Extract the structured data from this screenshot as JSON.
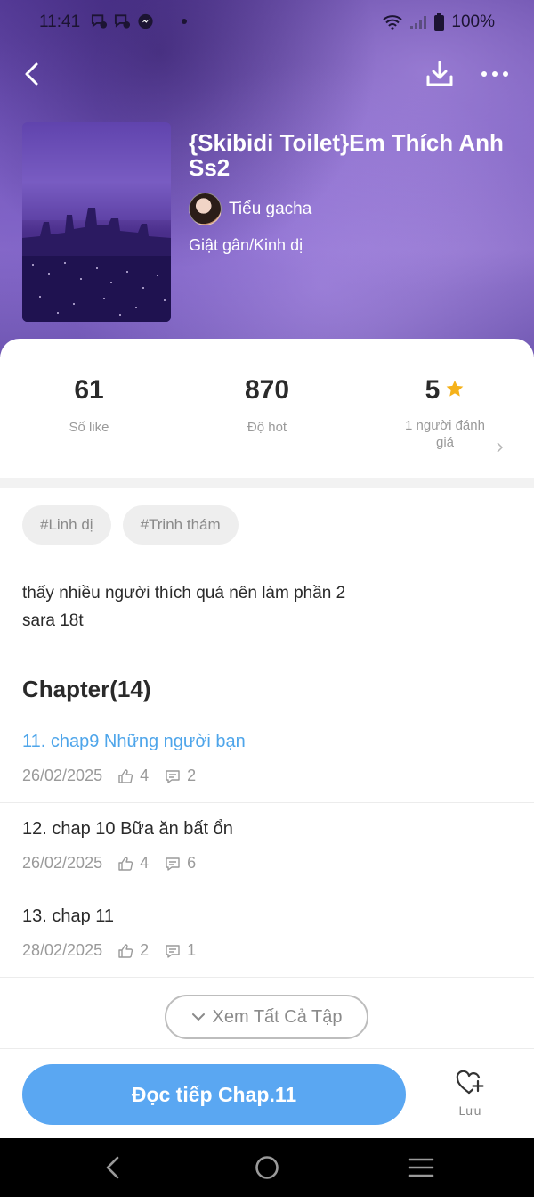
{
  "status_bar": {
    "time": "11:41",
    "battery": "100%"
  },
  "nav": {
    "back_icon": "chevron-left-icon",
    "download_icon": "download-icon",
    "more_icon": "more-horizontal-icon"
  },
  "book": {
    "title": "{Skibidi Toilet}Em Thích Anh Ss2",
    "author": "Tiểu gacha",
    "genre": "Giật gân/Kinh dị"
  },
  "stats": {
    "likes_value": "61",
    "likes_label": "Số like",
    "hot_value": "870",
    "hot_label": "Độ hot",
    "rating_value": "5",
    "rating_label": "1 người đánh giá"
  },
  "tags": [
    "#Linh dị",
    "#Trinh thám"
  ],
  "description": "thấy nhiều người thích quá nên làm phần 2\nsara 18t",
  "chapters_heading": "Chapter(14)",
  "chapters": [
    {
      "title": "11. chap9 Những người bạn",
      "date": "26/02/2025",
      "likes": "4",
      "comments": "2"
    },
    {
      "title": "12. chap 10 Bữa ăn bất ổn",
      "date": "26/02/2025",
      "likes": "4",
      "comments": "6"
    },
    {
      "title": "13. chap 11",
      "date": "28/02/2025",
      "likes": "2",
      "comments": "1"
    }
  ],
  "view_all_label": "Xem Tất Cả Tập",
  "bottom": {
    "read_label": "Đọc tiếp Chap.11",
    "save_label": "Lưu"
  },
  "colors": {
    "accent": "#5aa7f2",
    "active_chapter": "#4ea5ea",
    "star": "#f5b21b",
    "header_purple": "#7256b8"
  }
}
